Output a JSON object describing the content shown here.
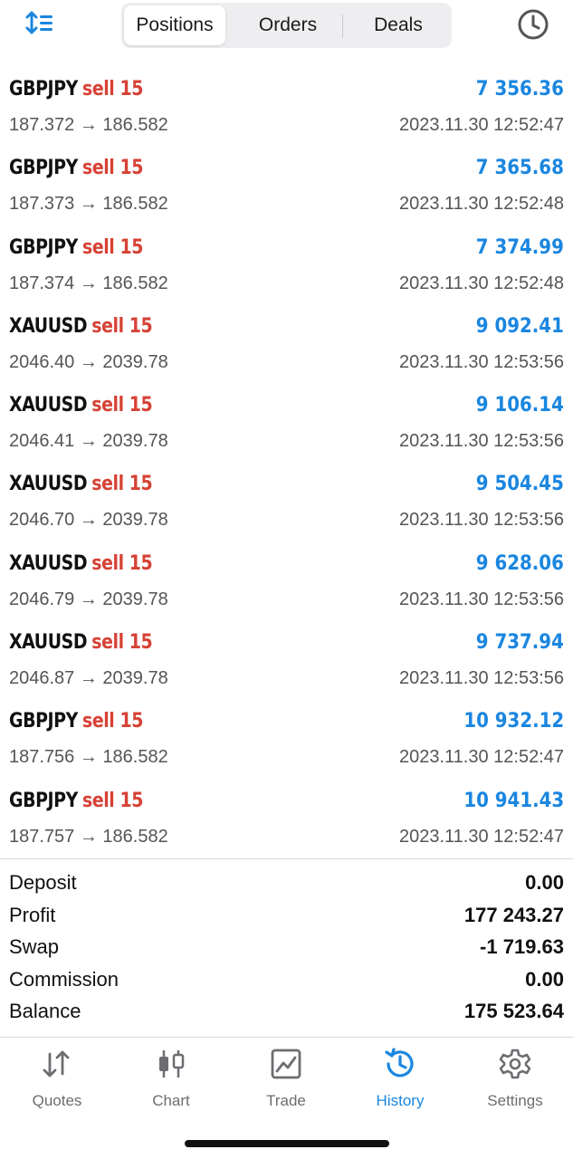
{
  "header": {
    "tabs": [
      "Positions",
      "Orders",
      "Deals"
    ],
    "active_tab": 0,
    "sort_icon": "sort-icon",
    "clock_icon": "clock-icon"
  },
  "deals": [
    {
      "symbol": "GBPJPY",
      "side": "sell 15",
      "profit": "7 356.36",
      "prices": "187.372 → 186.582",
      "time": "2023.11.30 12:52:47"
    },
    {
      "symbol": "GBPJPY",
      "side": "sell 15",
      "profit": "7 365.68",
      "prices": "187.373 → 186.582",
      "time": "2023.11.30 12:52:48"
    },
    {
      "symbol": "GBPJPY",
      "side": "sell 15",
      "profit": "7 374.99",
      "prices": "187.374 → 186.582",
      "time": "2023.11.30 12:52:48"
    },
    {
      "symbol": "XAUUSD",
      "side": "sell 15",
      "profit": "9 092.41",
      "prices": "2046.40 → 2039.78",
      "time": "2023.11.30 12:53:56"
    },
    {
      "symbol": "XAUUSD",
      "side": "sell 15",
      "profit": "9 106.14",
      "prices": "2046.41 → 2039.78",
      "time": "2023.11.30 12:53:56"
    },
    {
      "symbol": "XAUUSD",
      "side": "sell 15",
      "profit": "9 504.45",
      "prices": "2046.70 → 2039.78",
      "time": "2023.11.30 12:53:56"
    },
    {
      "symbol": "XAUUSD",
      "side": "sell 15",
      "profit": "9 628.06",
      "prices": "2046.79 → 2039.78",
      "time": "2023.11.30 12:53:56"
    },
    {
      "symbol": "XAUUSD",
      "side": "sell 15",
      "profit": "9 737.94",
      "prices": "2046.87 → 2039.78",
      "time": "2023.11.30 12:53:56"
    },
    {
      "symbol": "GBPJPY",
      "side": "sell 15",
      "profit": "10 932.12",
      "prices": "187.756 → 186.582",
      "time": "2023.11.30 12:52:47"
    },
    {
      "symbol": "GBPJPY",
      "side": "sell 15",
      "profit": "10 941.43",
      "prices": "187.757 → 186.582",
      "time": "2023.11.30 12:52:47"
    }
  ],
  "summary": [
    {
      "label": "Deposit",
      "value": "0.00"
    },
    {
      "label": "Profit",
      "value": "177 243.27"
    },
    {
      "label": "Swap",
      "value": "-1 719.63"
    },
    {
      "label": "Commission",
      "value": "0.00"
    },
    {
      "label": "Balance",
      "value": "175 523.64"
    }
  ],
  "tabbar": [
    {
      "label": "Quotes",
      "icon": "quotes-icon"
    },
    {
      "label": "Chart",
      "icon": "chart-icon"
    },
    {
      "label": "Trade",
      "icon": "trade-icon"
    },
    {
      "label": "History",
      "icon": "history-icon",
      "active": true
    },
    {
      "label": "Settings",
      "icon": "settings-icon"
    }
  ],
  "colors": {
    "accent": "#1a86e0",
    "sell": "#d64235",
    "muted": "#555555",
    "inactive": "#6d6d72"
  }
}
